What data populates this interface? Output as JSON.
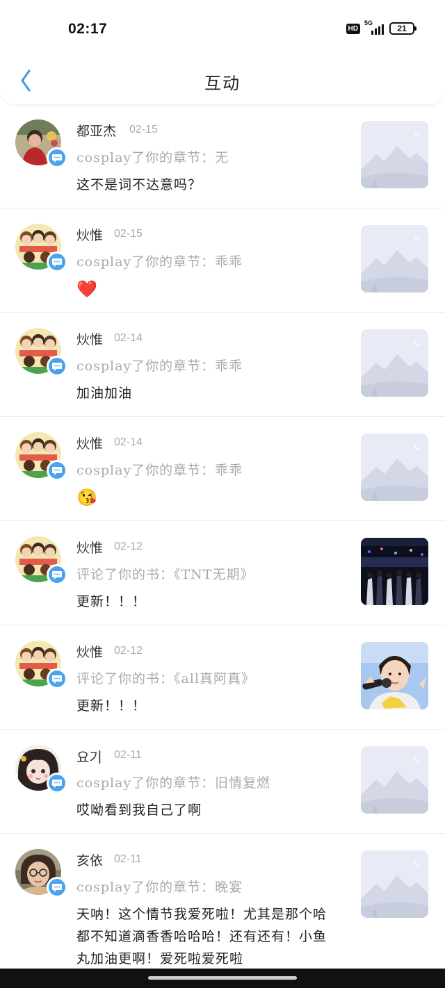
{
  "status_bar": {
    "time": "02:17",
    "hd": "HD",
    "network": "5G",
    "battery": "21"
  },
  "header": {
    "title": "互动"
  },
  "icons": {
    "back": "chevron-left-icon",
    "badge": "message-bubble-icon"
  },
  "colors": {
    "accent": "#4aa3ef",
    "placeholder_thumb": "#e8ebf5"
  },
  "items": [
    {
      "name": "都亚杰",
      "date": "02-15",
      "action": "cosplay了你的章节：无",
      "comment": "这不是词不达意吗？",
      "avatar": "photo-person",
      "thumb": "placeholder"
    },
    {
      "name": "炏惟",
      "date": "02-15",
      "action": "cosplay了你的章节：乖乖",
      "comment": "❤️",
      "avatar": "cartoon-group",
      "thumb": "placeholder"
    },
    {
      "name": "炏惟",
      "date": "02-14",
      "action": "cosplay了你的章节：乖乖",
      "comment": "加油加油",
      "avatar": "cartoon-group",
      "thumb": "placeholder"
    },
    {
      "name": "炏惟",
      "date": "02-14",
      "action": "cosplay了你的章节：乖乖",
      "comment": "😘",
      "avatar": "cartoon-group",
      "thumb": "placeholder"
    },
    {
      "name": "炏惟",
      "date": "02-12",
      "action": "评论了你的书：《TNT无期》",
      "comment": "更新！！！",
      "avatar": "cartoon-group",
      "thumb": "concert"
    },
    {
      "name": "炏惟",
      "date": "02-12",
      "action": "评论了你的书：《all真阿真》",
      "comment": "更新！！！",
      "avatar": "cartoon-group",
      "thumb": "portrait"
    },
    {
      "name": "요기",
      "date": "02-11",
      "action": "cosplay了你的章节：旧情复燃",
      "comment": "哎呦看到我自己了啊",
      "avatar": "anime-girl",
      "thumb": "placeholder"
    },
    {
      "name": "亥依",
      "date": "02-11",
      "action": "cosplay了你的章节：晚宴",
      "comment": "天呐！这个情节我爱死啦！尤其是那个哈都不知道滴香香哈哈哈！还有还有！小鱼丸加油更啊！爱死啦爱死啦",
      "avatar": "glasses-person",
      "thumb": "placeholder"
    }
  ]
}
